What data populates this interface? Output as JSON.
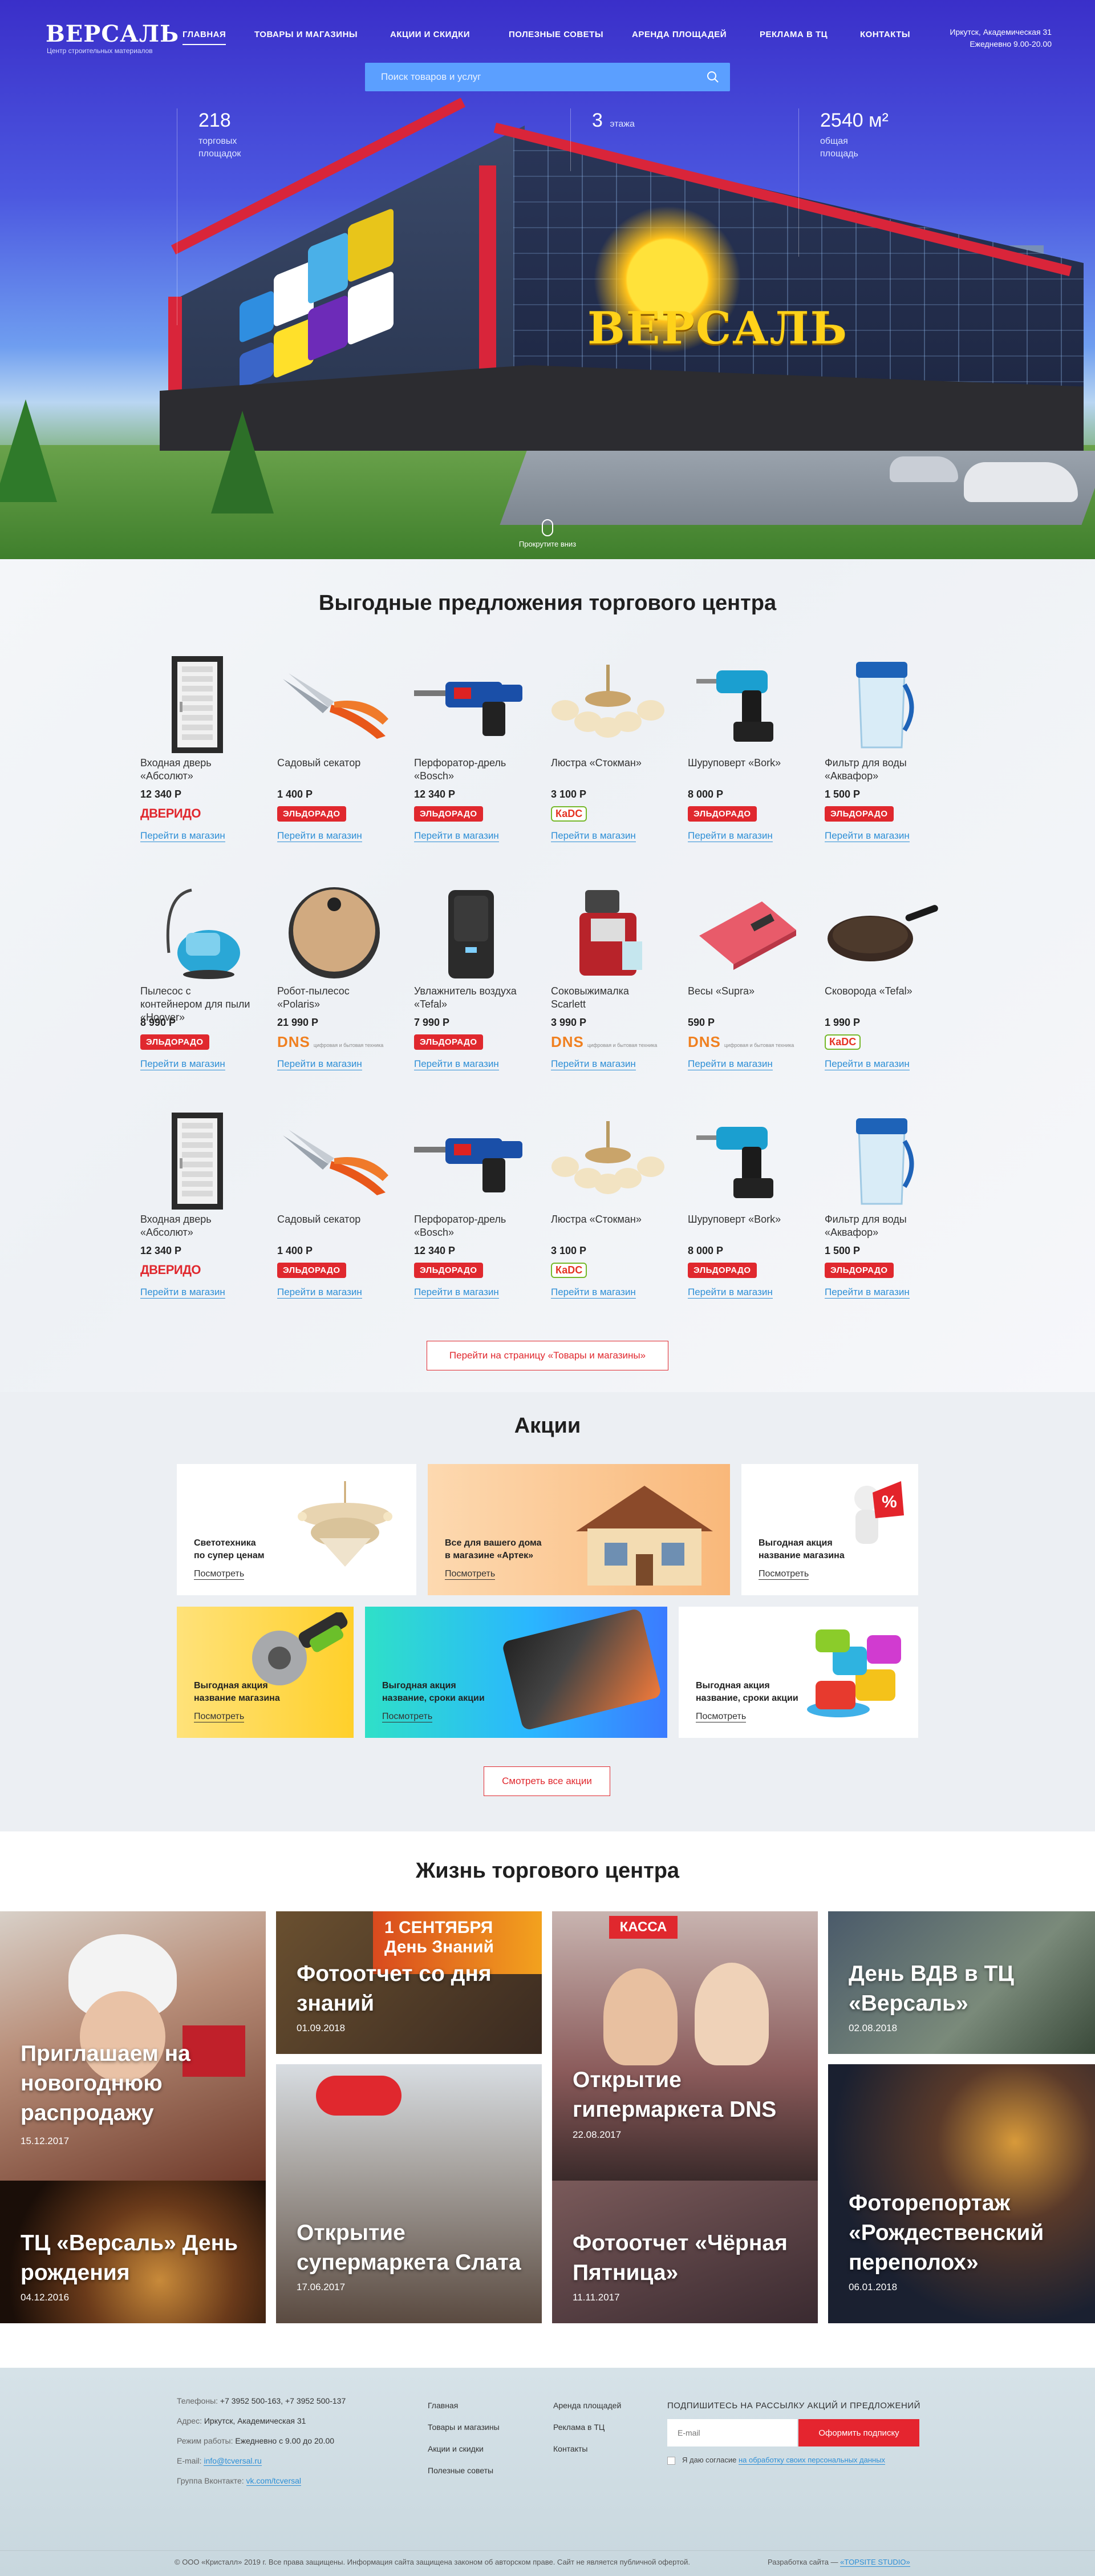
{
  "header": {
    "logo": "ВЕРСАЛЬ",
    "logo_sub": "Центр строительных материалов",
    "nav": [
      "ГЛАВНАЯ",
      "ТОВАРЫ И МАГАЗИНЫ",
      "АКЦИИ И СКИДКИ",
      "ПОЛЕЗНЫЕ СОВЕТЫ",
      "АРЕНДА ПЛОЩАДЕЙ",
      "РЕКЛАМА В ТЦ",
      "КОНТАКТЫ"
    ],
    "address": "Иркутск, Академическая 31",
    "hours": "Ежедневно 9.00-20.00"
  },
  "search": {
    "placeholder": "Поиск товаров и услуг"
  },
  "hero": {
    "stats": [
      {
        "num": "218",
        "label1": "торговых",
        "label2": "площадок"
      },
      {
        "num": "3",
        "label1": "этажа",
        "label2": ""
      },
      {
        "num": "2540 м²",
        "label1": "общая",
        "label2": "площадь"
      }
    ],
    "building_sign": "ВЕРСАЛЬ",
    "scroll_hint": "Прокрутите вниз"
  },
  "offers": {
    "title": "Выгодные предложения торгового центра",
    "link_label": "Перейти в магазин",
    "rows": [
      [
        {
          "name": "Входная дверь «Абсолют»",
          "price": "12 340 Р",
          "store": "dveri",
          "img": "door"
        },
        {
          "name": "Садовый секатор",
          "price": "1 400 Р",
          "store": "eldorado",
          "img": "pruner"
        },
        {
          "name": "Перфоратор-дрель «Bosch»",
          "price": "12 340 Р",
          "store": "eldorado",
          "img": "drill"
        },
        {
          "name": "Люстра «Стокман»",
          "price": "3 100 Р",
          "store": "kdc",
          "img": "lamp"
        },
        {
          "name": "Шуруповерт «Bork»",
          "price": "8 000 Р",
          "store": "eldorado",
          "img": "screwdriver"
        },
        {
          "name": "Фильтр для воды «Аквафор»",
          "price": "1 500 Р",
          "store": "eldorado",
          "img": "filter"
        }
      ],
      [
        {
          "name": "Пылесос с контейнером для пыли «Hoover»",
          "price": "8 990 Р",
          "store": "eldorado",
          "img": "vacuum"
        },
        {
          "name": "Робот-пылесос «Polaris»",
          "price": "21 990 Р",
          "store": "dns",
          "img": "robot"
        },
        {
          "name": "Увлажнитель воздуха «Tefal»",
          "price": "7 990 Р",
          "store": "eldorado",
          "img": "humidifier"
        },
        {
          "name": "Соковыжималка Scarlett",
          "price": "3 990 Р",
          "store": "dns",
          "img": "juicer"
        },
        {
          "name": "Весы «Supra»",
          "price": "590 Р",
          "store": "dns",
          "img": "scales"
        },
        {
          "name": "Сковорода «Tefal»",
          "price": "1 990 Р",
          "store": "kdc",
          "img": "pan"
        }
      ],
      [
        {
          "name": "Входная дверь «Абсолют»",
          "price": "12 340 Р",
          "store": "dveri",
          "img": "door"
        },
        {
          "name": "Садовый секатор",
          "price": "1 400 Р",
          "store": "eldorado",
          "img": "pruner"
        },
        {
          "name": "Перфоратор-дрель «Bosch»",
          "price": "12 340 Р",
          "store": "eldorado",
          "img": "drill"
        },
        {
          "name": "Люстра «Стокман»",
          "price": "3 100 Р",
          "store": "kdc",
          "img": "lamp"
        },
        {
          "name": "Шуруповерт «Bork»",
          "price": "8 000 Р",
          "store": "eldorado",
          "img": "screwdriver"
        },
        {
          "name": "Фильтр для воды «Аквафор»",
          "price": "1 500 Р",
          "store": "eldorado",
          "img": "filter"
        }
      ]
    ],
    "stores": {
      "eldorado": "ЭЛЬДОРАДО",
      "dveri": "ДВЕРИДО",
      "kdc": "КаDС",
      "dns": "DNS",
      "dns_sub": "цифровая и бытовая техника"
    },
    "more_button": "Перейти на страницу «Товары и магазины»"
  },
  "promos": {
    "title": "Акции",
    "look_label": "Посмотреть",
    "cards": [
      {
        "title1": "Светотехника",
        "title2": "по супер ценам",
        "title3": ""
      },
      {
        "title1": "Все для вашего дома",
        "title2": "в магазине «Артек»",
        "title3": ""
      },
      {
        "title1": "Выгодная акция",
        "title2": "название магазина",
        "title3": ""
      },
      {
        "title1": "Выгодная акция",
        "title2": "название магазина",
        "title3": ""
      },
      {
        "title1": "Выгодная акция",
        "title2": "название, сроки акции",
        "title3": ""
      },
      {
        "title1": "Выгодная акция",
        "title2": "название, сроки акции",
        "title3": ""
      }
    ],
    "all_button": "Смотреть все акции"
  },
  "life": {
    "title": "Жизнь торгового центра",
    "tiles": [
      {
        "title": "Приглашаем на новогоднюю распродажу",
        "date": "15.12.2017"
      },
      {
        "title": "Фотоотчет со дня знаний",
        "date": "01.09.2018",
        "sign": "1 СЕНТЯБРЯ День Знаний"
      },
      {
        "title": "Открытие гипермаркета DNS",
        "date": "22.08.2017",
        "sign": "КАССА"
      },
      {
        "title": "День ВДВ в ТЦ «Версаль»",
        "date": "02.08.2018"
      },
      {
        "title": "ТЦ «Версаль» День рождения",
        "date": "04.12.2016"
      },
      {
        "title": "Открытие супермаркета Слата",
        "date": "17.06.2017"
      },
      {
        "title": "Фотоотчет «Чёрная Пятница»",
        "date": "11.11.2017"
      },
      {
        "title": "Фоторепортаж «Рождественский переполох»",
        "date": "06.01.2018"
      }
    ]
  },
  "footer": {
    "phones_label": "Телефоны:",
    "phones": "+7 3952 500-163, +7 3952 500-137",
    "address_label": "Адрес:",
    "address": "Иркутск, Академическая 31",
    "hours_label": "Режим работы:",
    "hours": "Ежедневно с 9.00 до 20.00",
    "email_label": "E-mail:",
    "email": "info@tcversal.ru",
    "vk_label": "Группа Вконтакте:",
    "vk": "vk.com/tcversal",
    "menu1": [
      "Главная",
      "Товары и магазины",
      "Акции и скидки",
      "Полезные советы"
    ],
    "menu2": [
      "Аренда площадей",
      "Реклама в ТЦ",
      "Контакты"
    ],
    "subscribe_title": "ПОДПИШИТЕСЬ НА РАССЫЛКУ АКЦИЙ И ПРЕДЛОЖЕНИЙ",
    "email_placeholder": "E-mail",
    "subscribe_button": "Оформить подписку",
    "agree_text": "Я даю согласие ",
    "agree_link": "на обработку своих персональных данных",
    "copyright": "© ООО «Кристалл» 2019 г. Все права защищены. Информация сайта защищена законом об авторском праве. Сайт не является публичной офертой.",
    "dev_label": "Разработка сайта — ",
    "dev_link": "«TOPSITE STUDIO»"
  },
  "colors": {
    "accent_red": "#e0282e",
    "link_blue": "#2e8fd6",
    "search_blue": "#5b9fff"
  }
}
